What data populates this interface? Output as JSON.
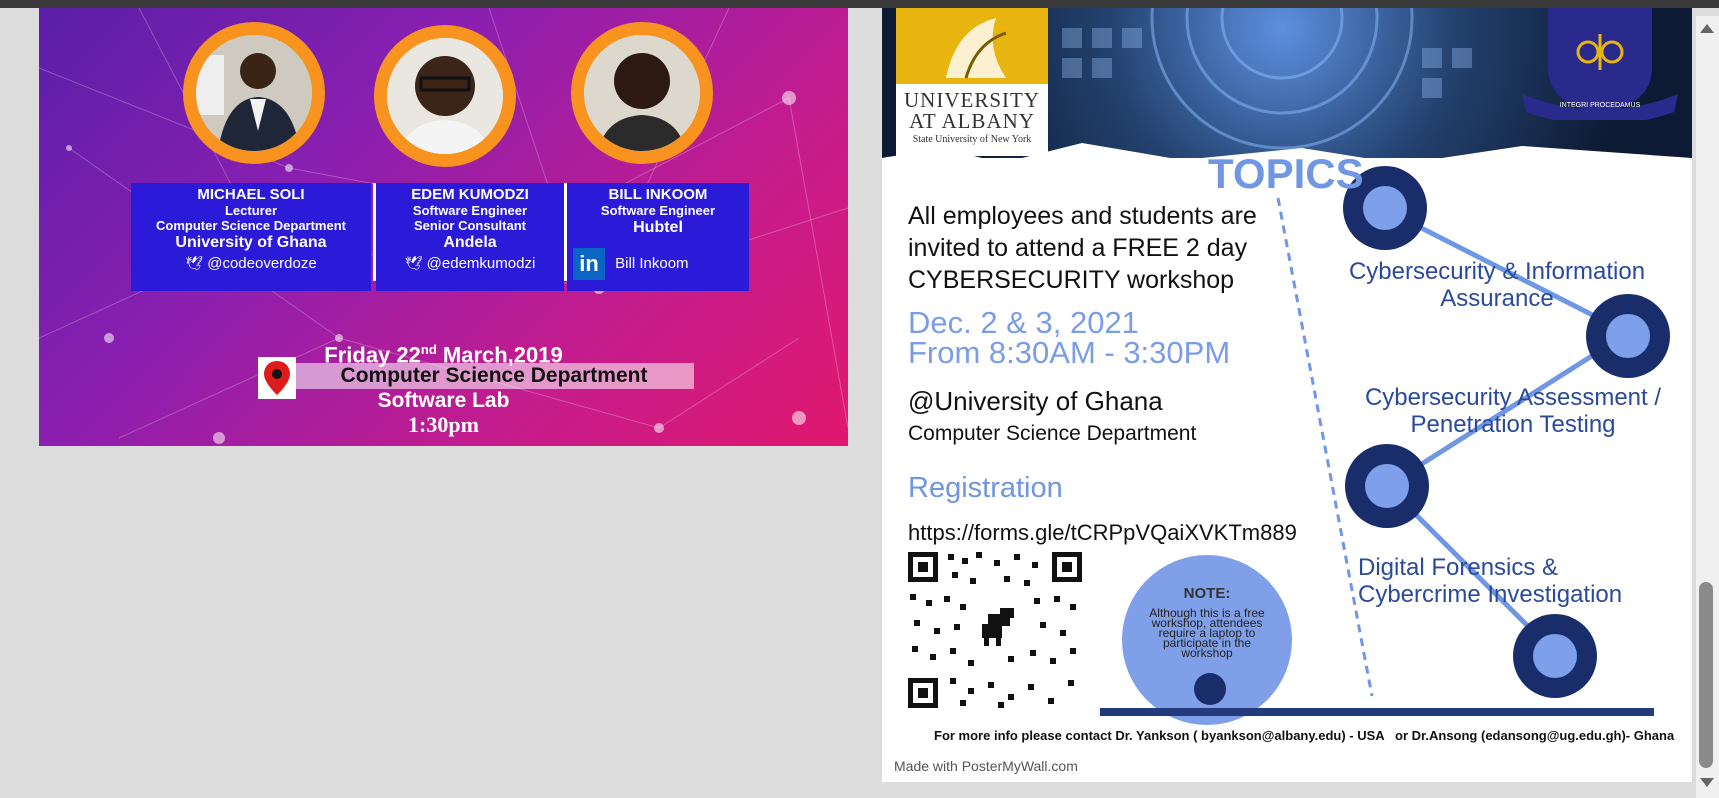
{
  "left_poster": {
    "speakers": [
      {
        "name": "MICHAEL SOLI",
        "line1": "Lecturer",
        "line2": "Computer Science Department",
        "org": "University of Ghana",
        "handle": "@codeoverdoze",
        "icon": "twitter-bird-icon"
      },
      {
        "name": "EDEM KUMODZI",
        "line1": "Software Engineer",
        "line2": "Senior Consultant",
        "org": "Andela",
        "handle": "@edemkumodzi",
        "icon": "twitter-bird-icon"
      },
      {
        "name": "BILL INKOOM",
        "line1": "Software Engineer",
        "line2": "",
        "org": "Hubtel",
        "handle": "Bill Inkoom",
        "icon": "linkedin-icon"
      }
    ],
    "event": {
      "date_prefix": "Friday 22",
      "date_sup": "nd",
      "date_suffix": " March,2019",
      "department": "Computer Science Department",
      "lab": "Software Lab",
      "time": "1:30pm"
    }
  },
  "right_poster": {
    "logo": {
      "line1": "UNIVERSITY",
      "line2": "AT ALBANY",
      "line3": "State University of New York"
    },
    "crest_motto": "INTEGRI PROCEDAMUS",
    "topics_title": "TOPICS",
    "invite": "All employees and students are invited to attend a FREE 2 day CYBERSECURITY workshop",
    "dates_line1": "Dec. 2 & 3, 2021",
    "dates_line2": "From 8:30AM - 3:30PM",
    "venue": "@University of Ghana",
    "department": "Computer Science Department",
    "registration_label": "Registration",
    "registration_url": "https://forms.gle/tCRPpVQaiXVKTm889",
    "note_title": "NOTE:",
    "note_body": "Although this is a free workshop, attendees require a laptop to participate in the workshop",
    "topics": [
      "Cybersecurity & Information Assurance",
      "Cybersecurity Assessment / Penetration Testing",
      "Digital Forensics & Cybercrime Investigation"
    ],
    "contact": "For more info please contact Dr. Yankson ( byankson@albany.edu) - USA   or Dr.Ansong (edansong@ug.edu.gh)- Ghana",
    "made_with": "Made with PosterMyWall.com"
  },
  "colors": {
    "accent": "#6f95e4",
    "navy": "#1a2d6b",
    "orange": "#f7931e",
    "box_blue": "#2b1ad8"
  }
}
